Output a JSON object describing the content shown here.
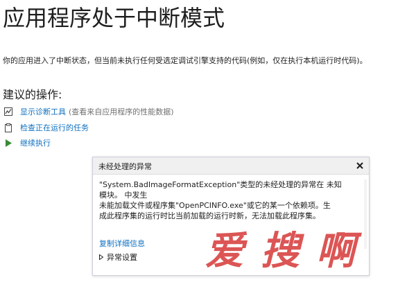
{
  "page": {
    "title": "应用程序处于中断模式",
    "description": "你的应用进入了中断状态，但当前未执行任何受选定调试引擎支持的代码(例如，仅在执行本机运行时代码)。"
  },
  "actions": {
    "heading": "建议的操作:",
    "items": [
      {
        "icon": "diagnostics-icon",
        "label": "显示诊断工具",
        "hint": "(查看来自应用程序的性能数据)"
      },
      {
        "icon": "clipboard-icon",
        "label": "检查正在运行的任务",
        "hint": ""
      },
      {
        "icon": "play-icon",
        "label": "继续执行",
        "hint": ""
      }
    ]
  },
  "exception_popup": {
    "title": "未经处理的异常",
    "message_lines": [
      "\"System.BadImageFormatException\"类型的未经处理的异常在 未知",
      "模块。 中发生",
      "未能加载文件或程序集\"OpenPCINFO.exe\"或它的某一个依赖项。生",
      "成此程序集的运行时比当前加载的运行时新，无法加载此程序集。"
    ],
    "copy_details_label": "复制详细信息",
    "exception_settings_label": "异常设置"
  },
  "watermark": {
    "text": "爱搜啊"
  },
  "colors": {
    "link": "#0e70c0",
    "play": "#388a34",
    "watermark": "#d43030"
  }
}
